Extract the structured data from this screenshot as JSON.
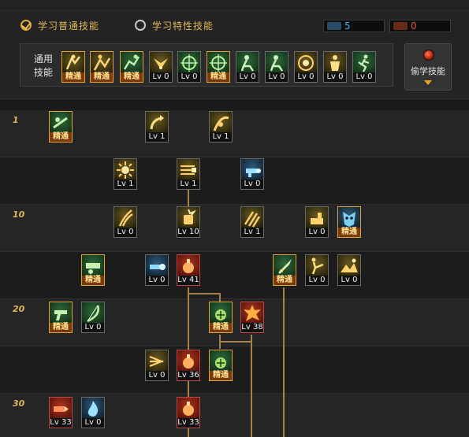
{
  "tabs": {
    "normal_label": "学习普通技能",
    "special_label": "学习特性技能"
  },
  "points": {
    "blue_value": "5",
    "red_value": "0",
    "blue_color": "#4fa8e8",
    "red_color": "#e0503a"
  },
  "common_skills": {
    "label_line1": "通用",
    "label_line2": "技能",
    "items": [
      {
        "caption": "精通",
        "mastered": true,
        "icon": "scroll-figure-icon",
        "tone": "gold"
      },
      {
        "caption": "精通",
        "mastered": true,
        "icon": "stomp-figure-icon",
        "tone": "gold"
      },
      {
        "caption": "精通",
        "mastered": true,
        "icon": "leap-figure-icon",
        "tone": "green"
      },
      {
        "caption": "Lv 0",
        "mastered": false,
        "icon": "wings-icon",
        "tone": "gold"
      },
      {
        "caption": "Lv 0",
        "mastered": false,
        "icon": "crosshair-orb-icon",
        "tone": "green"
      },
      {
        "caption": "精通",
        "mastered": true,
        "icon": "crosshair-orb-icon",
        "tone": "green"
      },
      {
        "caption": "Lv 0",
        "mastered": false,
        "icon": "kneel-figure-icon",
        "tone": "green"
      },
      {
        "caption": "Lv 0",
        "mastered": false,
        "icon": "kneel-figure-icon",
        "tone": "green"
      },
      {
        "caption": "Lv 0",
        "mastered": false,
        "icon": "eye-ring-icon",
        "tone": "gold"
      },
      {
        "caption": "Lv 0",
        "mastered": false,
        "icon": "warrior-figure-icon",
        "tone": "gold"
      },
      {
        "caption": "Lv 0",
        "mastered": false,
        "icon": "run-figure-icon",
        "tone": "green"
      }
    ]
  },
  "steal_button": {
    "label": "偷学技能"
  },
  "tree": {
    "level_labels": {
      "1": "1",
      "10": "10",
      "20": "20",
      "30": "30"
    },
    "skills": [
      {
        "id": "r1-a",
        "caption": "精通",
        "mastered": true,
        "icon": "rifle-figure-icon",
        "tone": "green"
      },
      {
        "id": "r1-b",
        "caption": "Lv 1",
        "mastered": false,
        "icon": "curved-arrow-icon",
        "tone": "gold"
      },
      {
        "id": "r1-c",
        "caption": "Lv 1",
        "mastered": false,
        "icon": "slash-figure-icon",
        "tone": "gold"
      },
      {
        "id": "r2-a",
        "caption": "Lv 1",
        "mastered": false,
        "icon": "burst-icon",
        "tone": "gold"
      },
      {
        "id": "r2-b",
        "caption": "Lv 1",
        "mastered": false,
        "icon": "rapid-shot-icon",
        "tone": "gold"
      },
      {
        "id": "r2-c",
        "caption": "Lv 0",
        "mastered": false,
        "icon": "gun-blast-icon",
        "tone": "blue"
      },
      {
        "id": "r3-a",
        "caption": "Lv 0",
        "mastered": false,
        "icon": "claw-slash-icon",
        "tone": "gold"
      },
      {
        "id": "r3-b",
        "caption": "Lv 10",
        "mastered": false,
        "icon": "fist-burst-icon",
        "tone": "gold"
      },
      {
        "id": "r3-c",
        "caption": "Lv 1",
        "mastered": false,
        "icon": "triple-slash-icon",
        "tone": "gold"
      },
      {
        "id": "r3-d",
        "caption": "Lv 0",
        "mastered": false,
        "icon": "cannon-icon",
        "tone": "gold"
      },
      {
        "id": "r3-e",
        "caption": "精通",
        "mastered": true,
        "icon": "mask-face-icon",
        "tone": "blue"
      },
      {
        "id": "r4-a",
        "caption": "精通",
        "mastered": true,
        "icon": "launcher-figure-icon",
        "tone": "green"
      },
      {
        "id": "r4-b",
        "caption": "Lv 0",
        "mastered": false,
        "icon": "plasma-gun-icon",
        "tone": "blue"
      },
      {
        "id": "r4-c",
        "caption": "Lv 41",
        "mastered": false,
        "icon": "grenade-icon",
        "tone": "red"
      },
      {
        "id": "r4-d",
        "caption": "精通",
        "mastered": true,
        "icon": "rocket-icon",
        "tone": "green"
      },
      {
        "id": "r4-e",
        "caption": "Lv 0",
        "mastered": false,
        "icon": "kick-figure-icon",
        "tone": "gold"
      },
      {
        "id": "r4-f",
        "caption": "Lv 0",
        "mastered": false,
        "icon": "landscape-icon",
        "tone": "gold"
      },
      {
        "id": "r5-a",
        "caption": "精通",
        "mastered": true,
        "icon": "pistol-icon",
        "tone": "green"
      },
      {
        "id": "r5-b",
        "caption": "Lv 0",
        "mastered": false,
        "icon": "bow-icon",
        "tone": "green"
      },
      {
        "id": "r5-c",
        "caption": "精通",
        "mastered": true,
        "icon": "frag-grenade-icon",
        "tone": "green"
      },
      {
        "id": "r5-d",
        "caption": "Lv 38",
        "mastered": false,
        "icon": "explosion-icon",
        "tone": "red"
      },
      {
        "id": "r6-a",
        "caption": "Lv 0",
        "mastered": false,
        "icon": "multi-shot-icon",
        "tone": "gold"
      },
      {
        "id": "r6-b",
        "caption": "Lv 36",
        "mastered": false,
        "icon": "grenade-icon",
        "tone": "red"
      },
      {
        "id": "r6-c",
        "caption": "精通",
        "mastered": true,
        "icon": "frag-grenade-icon",
        "tone": "green"
      },
      {
        "id": "r7-a",
        "caption": "Lv 33",
        "mastered": false,
        "icon": "bullet-icon",
        "tone": "red"
      },
      {
        "id": "r7-b",
        "caption": "Lv 0",
        "mastered": false,
        "icon": "flame-icon",
        "tone": "blue"
      },
      {
        "id": "r7-c",
        "caption": "Lv 33",
        "mastered": false,
        "icon": "grenade-icon",
        "tone": "red"
      }
    ]
  }
}
